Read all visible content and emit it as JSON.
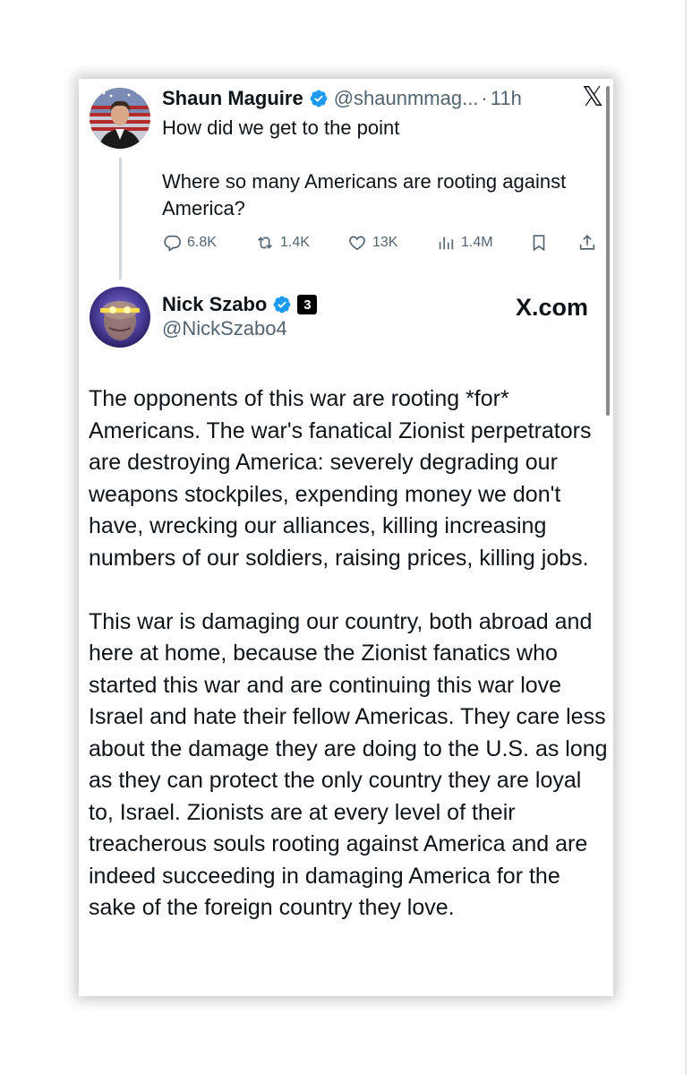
{
  "tweet1": {
    "name": "Shaun Maguire",
    "handle": "@shaunmmag...",
    "separator": "·",
    "time": "11h",
    "text": "How did we get to the point\n\nWhere so many Americans are rooting against America?",
    "actions": {
      "replies": "6.8K",
      "reposts": "1.4K",
      "likes": "13K",
      "views": "1.4M"
    },
    "icons": [
      "reply-icon",
      "repost-icon",
      "like-icon",
      "views-icon",
      "bookmark-icon",
      "share-icon"
    ]
  },
  "tweet2": {
    "name": "Nick Szabo",
    "badge": "3",
    "handle": "@NickSzabo4",
    "watermark": "X.com",
    "paragraphs": [
      "The opponents of this war are rooting *for* Americans.  The war's fanatical Zionist perpetrators are destroying America: severely degrading our weapons stockpiles, expending money we don't have, wrecking our alliances, killing increasing numbers of our soldiers, raising prices, killing jobs.",
      "This war is damaging our country, both abroad and here at home, because the Zionist fanatics who started this war and are continuing this war love Israel and hate their fellow Americas.  They care less about the damage they are doing to the U.S. as long as they can protect the only country they are loyal to, Israel.  Zionists are at every level of their treacherous souls rooting against America and are indeed succeeding in damaging America for the sake of the foreign country they love."
    ]
  },
  "x_logo": "𝕏",
  "colors": {
    "verified": "#1d9bf0",
    "text": "#0f1419",
    "muted": "#536471"
  }
}
